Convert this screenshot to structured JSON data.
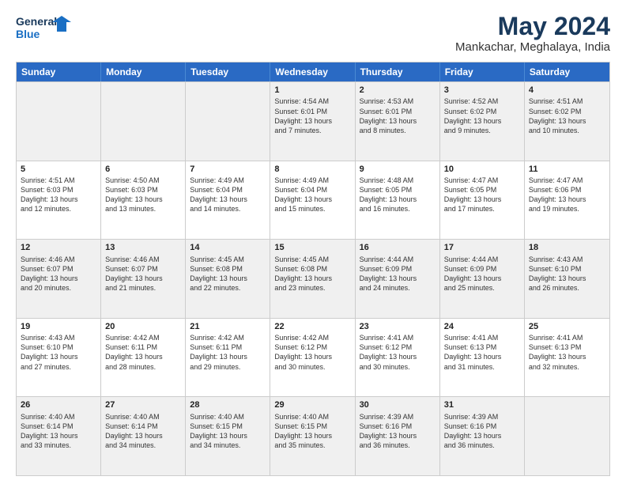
{
  "logo": {
    "line1": "General",
    "line2": "Blue"
  },
  "title": "May 2024",
  "subtitle": "Mankachar, Meghalaya, India",
  "weekdays": [
    "Sunday",
    "Monday",
    "Tuesday",
    "Wednesday",
    "Thursday",
    "Friday",
    "Saturday"
  ],
  "rows": [
    [
      {
        "day": "",
        "text": ""
      },
      {
        "day": "",
        "text": ""
      },
      {
        "day": "",
        "text": ""
      },
      {
        "day": "1",
        "text": "Sunrise: 4:54 AM\nSunset: 6:01 PM\nDaylight: 13 hours\nand 7 minutes."
      },
      {
        "day": "2",
        "text": "Sunrise: 4:53 AM\nSunset: 6:01 PM\nDaylight: 13 hours\nand 8 minutes."
      },
      {
        "day": "3",
        "text": "Sunrise: 4:52 AM\nSunset: 6:02 PM\nDaylight: 13 hours\nand 9 minutes."
      },
      {
        "day": "4",
        "text": "Sunrise: 4:51 AM\nSunset: 6:02 PM\nDaylight: 13 hours\nand 10 minutes."
      }
    ],
    [
      {
        "day": "5",
        "text": "Sunrise: 4:51 AM\nSunset: 6:03 PM\nDaylight: 13 hours\nand 12 minutes."
      },
      {
        "day": "6",
        "text": "Sunrise: 4:50 AM\nSunset: 6:03 PM\nDaylight: 13 hours\nand 13 minutes."
      },
      {
        "day": "7",
        "text": "Sunrise: 4:49 AM\nSunset: 6:04 PM\nDaylight: 13 hours\nand 14 minutes."
      },
      {
        "day": "8",
        "text": "Sunrise: 4:49 AM\nSunset: 6:04 PM\nDaylight: 13 hours\nand 15 minutes."
      },
      {
        "day": "9",
        "text": "Sunrise: 4:48 AM\nSunset: 6:05 PM\nDaylight: 13 hours\nand 16 minutes."
      },
      {
        "day": "10",
        "text": "Sunrise: 4:47 AM\nSunset: 6:05 PM\nDaylight: 13 hours\nand 17 minutes."
      },
      {
        "day": "11",
        "text": "Sunrise: 4:47 AM\nSunset: 6:06 PM\nDaylight: 13 hours\nand 19 minutes."
      }
    ],
    [
      {
        "day": "12",
        "text": "Sunrise: 4:46 AM\nSunset: 6:07 PM\nDaylight: 13 hours\nand 20 minutes."
      },
      {
        "day": "13",
        "text": "Sunrise: 4:46 AM\nSunset: 6:07 PM\nDaylight: 13 hours\nand 21 minutes."
      },
      {
        "day": "14",
        "text": "Sunrise: 4:45 AM\nSunset: 6:08 PM\nDaylight: 13 hours\nand 22 minutes."
      },
      {
        "day": "15",
        "text": "Sunrise: 4:45 AM\nSunset: 6:08 PM\nDaylight: 13 hours\nand 23 minutes."
      },
      {
        "day": "16",
        "text": "Sunrise: 4:44 AM\nSunset: 6:09 PM\nDaylight: 13 hours\nand 24 minutes."
      },
      {
        "day": "17",
        "text": "Sunrise: 4:44 AM\nSunset: 6:09 PM\nDaylight: 13 hours\nand 25 minutes."
      },
      {
        "day": "18",
        "text": "Sunrise: 4:43 AM\nSunset: 6:10 PM\nDaylight: 13 hours\nand 26 minutes."
      }
    ],
    [
      {
        "day": "19",
        "text": "Sunrise: 4:43 AM\nSunset: 6:10 PM\nDaylight: 13 hours\nand 27 minutes."
      },
      {
        "day": "20",
        "text": "Sunrise: 4:42 AM\nSunset: 6:11 PM\nDaylight: 13 hours\nand 28 minutes."
      },
      {
        "day": "21",
        "text": "Sunrise: 4:42 AM\nSunset: 6:11 PM\nDaylight: 13 hours\nand 29 minutes."
      },
      {
        "day": "22",
        "text": "Sunrise: 4:42 AM\nSunset: 6:12 PM\nDaylight: 13 hours\nand 30 minutes."
      },
      {
        "day": "23",
        "text": "Sunrise: 4:41 AM\nSunset: 6:12 PM\nDaylight: 13 hours\nand 30 minutes."
      },
      {
        "day": "24",
        "text": "Sunrise: 4:41 AM\nSunset: 6:13 PM\nDaylight: 13 hours\nand 31 minutes."
      },
      {
        "day": "25",
        "text": "Sunrise: 4:41 AM\nSunset: 6:13 PM\nDaylight: 13 hours\nand 32 minutes."
      }
    ],
    [
      {
        "day": "26",
        "text": "Sunrise: 4:40 AM\nSunset: 6:14 PM\nDaylight: 13 hours\nand 33 minutes."
      },
      {
        "day": "27",
        "text": "Sunrise: 4:40 AM\nSunset: 6:14 PM\nDaylight: 13 hours\nand 34 minutes."
      },
      {
        "day": "28",
        "text": "Sunrise: 4:40 AM\nSunset: 6:15 PM\nDaylight: 13 hours\nand 34 minutes."
      },
      {
        "day": "29",
        "text": "Sunrise: 4:40 AM\nSunset: 6:15 PM\nDaylight: 13 hours\nand 35 minutes."
      },
      {
        "day": "30",
        "text": "Sunrise: 4:39 AM\nSunset: 6:16 PM\nDaylight: 13 hours\nand 36 minutes."
      },
      {
        "day": "31",
        "text": "Sunrise: 4:39 AM\nSunset: 6:16 PM\nDaylight: 13 hours\nand 36 minutes."
      },
      {
        "day": "",
        "text": ""
      }
    ]
  ]
}
